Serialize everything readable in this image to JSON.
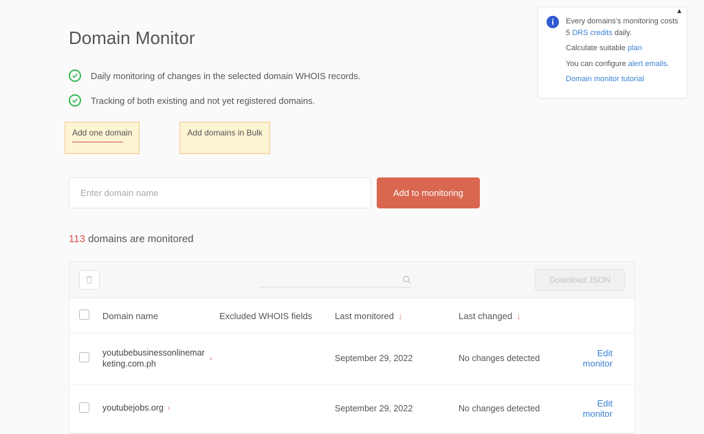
{
  "page": {
    "title": "Domain Monitor"
  },
  "features": [
    "Daily monitoring of changes in the selected domain WHOIS records.",
    "Tracking of both existing and not yet registered domains."
  ],
  "tabs": {
    "add_one": "Add one domain",
    "add_bulk": "Add domains in Bulk"
  },
  "form": {
    "placeholder": "Enter domain name",
    "add_button": "Add to monitoring"
  },
  "monitored": {
    "count": "113",
    "suffix": " domains are monitored"
  },
  "toolbar": {
    "download": "Download JSON"
  },
  "table": {
    "headers": {
      "domain": "Domain name",
      "excluded": "Excluded WHOIS fields",
      "last_monitored": "Last monitored",
      "last_changed": "Last changed"
    },
    "rows": [
      {
        "domain": "youtubebusinessonlinemarketing.com.ph",
        "excluded": "",
        "last_monitored": "September 29, 2022",
        "last_changed": "No changes detected",
        "action": "Edit monitor"
      },
      {
        "domain": "youtubejobs.org",
        "excluded": "",
        "last_monitored": "September 29, 2022",
        "last_changed": "No changes detected",
        "action": "Edit monitor"
      }
    ]
  },
  "info_panel": {
    "line1a": "Every domains's monitoring costs 5 ",
    "line1b": "DRS credits",
    "line1c": " daily.",
    "line2a": "Calculate suitable ",
    "line2b": "plan",
    "line3a": "You can configure ",
    "line3b": "alert emails",
    "line3c": ".",
    "line4": "Domain monitor tutorial"
  }
}
